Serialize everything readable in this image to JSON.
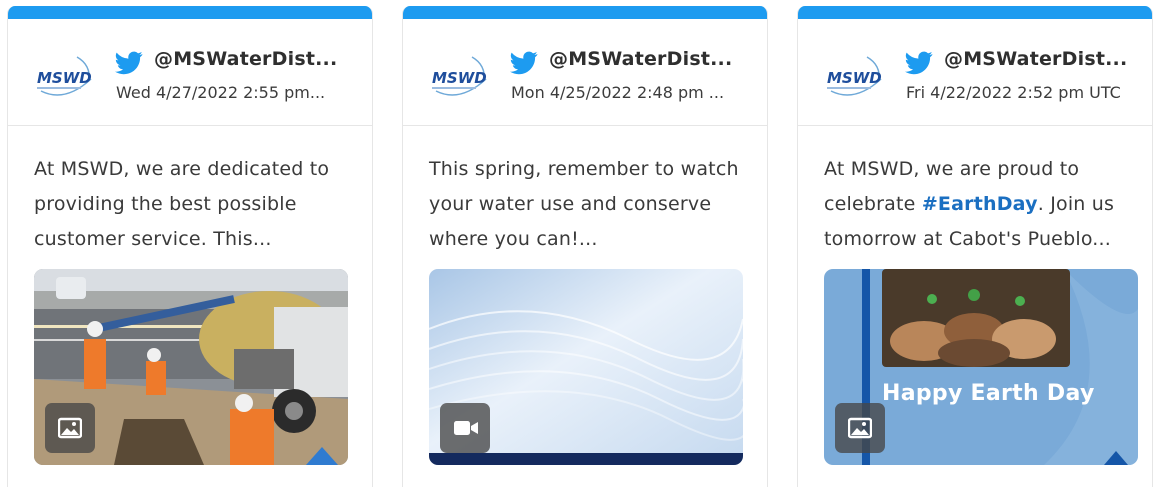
{
  "cards": [
    {
      "handle": "@MSWaterDist...",
      "date": "Wed 4/27/2022 2:55 pm...",
      "text": "At MSWD, we are dedicated to providing the best possible customer service. This...",
      "media_type": "image-icon"
    },
    {
      "handle": "@MSWaterDist...",
      "date": "Mon 4/25/2022 2:48 pm ...",
      "text": "This spring, remember to watch your water use and conserve where you can!...",
      "media_type": "video-icon"
    },
    {
      "handle": "@MSWaterDist...",
      "date": "Fri 4/22/2022 2:52 pm UTC",
      "text_before": "At MSWD, we are proud to celebrate ",
      "hashtag": "#EarthDay",
      "text_after": ". Join us tomorrow at Cabot's Pueblo...",
      "media_overlay": "Happy Earth Day",
      "media_type": "image-icon"
    }
  ],
  "logo_text": "MSWD",
  "colors": {
    "accent": "#1d9bf0",
    "hashtag": "#1b6fc1",
    "text": "#3a3a3a"
  }
}
